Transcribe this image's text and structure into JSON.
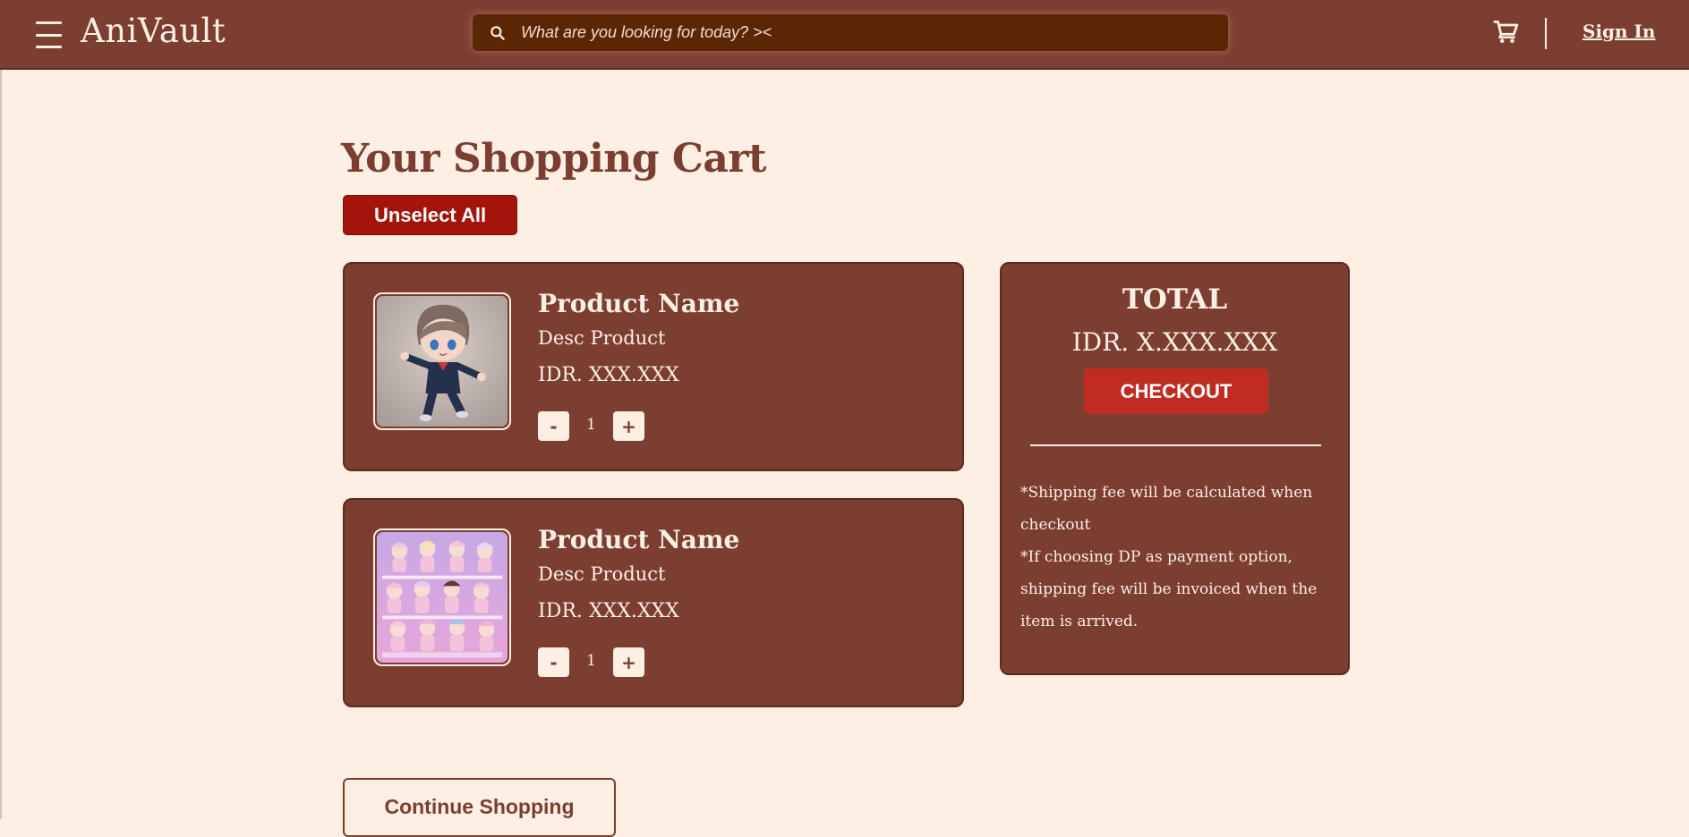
{
  "header": {
    "logo": "AniVault",
    "search": {
      "placeholder": "What are you looking for today? ><",
      "value": ""
    },
    "sign_in": "Sign In",
    "icons": [
      "menu-icon",
      "search-icon",
      "cart-icon"
    ]
  },
  "main": {
    "title": "Your Shopping Cart",
    "unselect_all_label": "Unselect All",
    "items": [
      {
        "name": "Product Name",
        "desc": "Desc Product",
        "price": "IDR. XXX.XXX",
        "quantity": "1",
        "minus_label": "-",
        "plus_label": "+",
        "image": "figure-boy-school-uniform"
      },
      {
        "name": "Product Name",
        "desc": "Desc Product",
        "price": "IDR. XXX.XXX",
        "quantity": "1",
        "minus_label": "-",
        "plus_label": "+",
        "image": "figure-collection-pink"
      }
    ],
    "continue_label": "Continue Shopping"
  },
  "summary": {
    "total_label": "TOTAL",
    "total_value": "IDR. X.XXX.XXX",
    "checkout_label": "CHECKOUT",
    "note_1": "*Shipping fee will be calculated when checkout",
    "note_2": "*If choosing DP as payment option, shipping fee will be invoiced when the item is arrived."
  },
  "colors": {
    "brand": "#7b3e31",
    "background": "#fdefe4",
    "search_bg": "#5a2604",
    "unselect_button": "#a3140c",
    "checkout_button": "#c02c22"
  }
}
